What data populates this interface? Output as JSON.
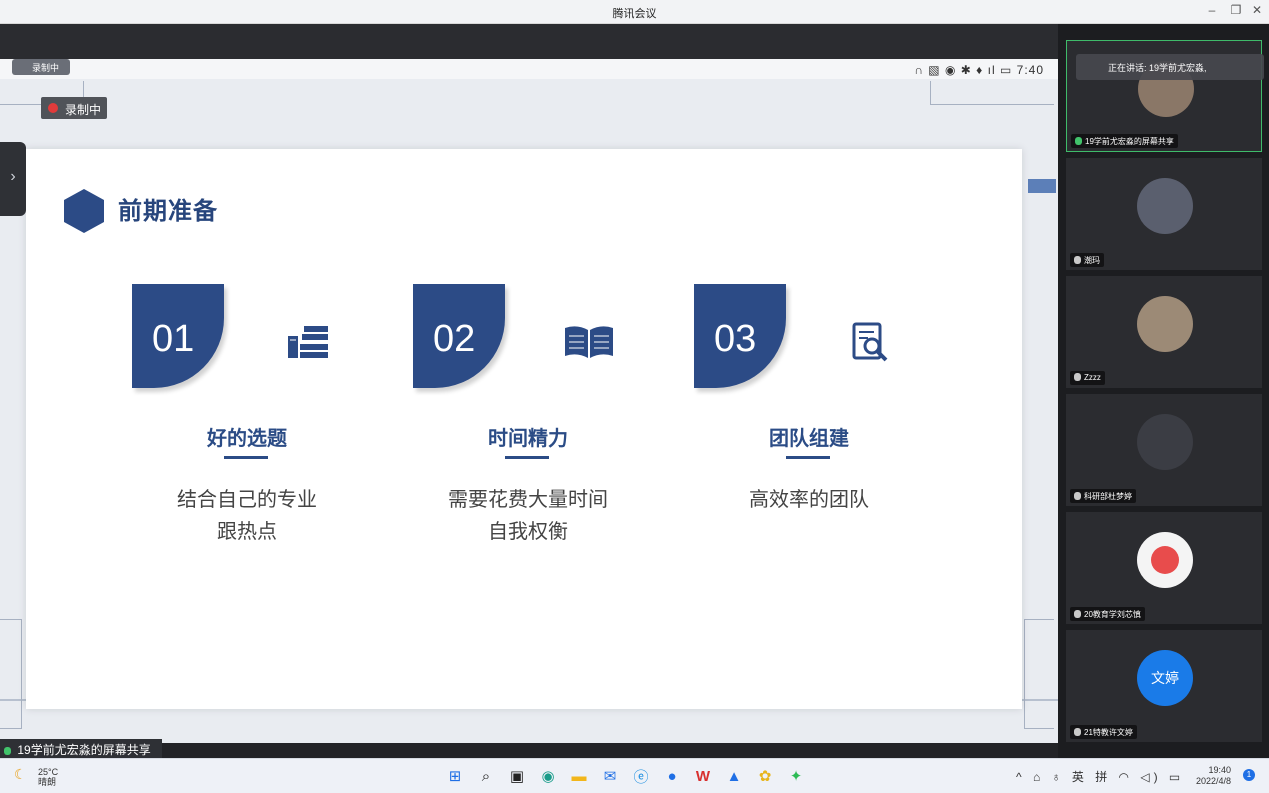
{
  "window": {
    "title": "腾讯会议",
    "min": "–",
    "restore": "❐",
    "close": "✕"
  },
  "phone": {
    "rec_small": "录制中",
    "rec_badge": "录制中",
    "status_icons": "∩ ▧ ◉ ✱ ♦ ıl ▭",
    "time": "7:40",
    "side_handle": "›"
  },
  "slide": {
    "title": "前期准备",
    "cards": [
      {
        "num": "01",
        "icon": "books-icon",
        "title": "好的选题",
        "desc": [
          "结合自己的专业",
          "跟热点"
        ]
      },
      {
        "num": "02",
        "icon": "open-book-icon",
        "title": "时间精力",
        "desc": [
          "需要花费大量时间",
          "自我权衡"
        ]
      },
      {
        "num": "03",
        "icon": "document-search-icon",
        "title": "团队组建",
        "desc": [
          "高效率的团队"
        ]
      }
    ],
    "accent": "#2c4b86"
  },
  "share_label": "19学前尤宏淼的屏幕共享",
  "speaking": "正在讲话: 19学前尤宏淼,",
  "participants": [
    {
      "name": "19学前尤宏淼的屏幕共享",
      "active": true
    },
    {
      "name": "潮玛"
    },
    {
      "name": "Zzzz"
    },
    {
      "name": "科研部杜梦婷"
    },
    {
      "name": "20教育学刘芯慎"
    },
    {
      "name": "21特教许文婷",
      "avatar_text": "文婷"
    }
  ],
  "taskbar": {
    "temp": "25°C",
    "weather": "晴朗",
    "tray": "^ ⌂ ♁ 英 拼 ◠ ◁) ▭",
    "time": "19:40",
    "date": "2022/4/8",
    "notifications": "1"
  }
}
